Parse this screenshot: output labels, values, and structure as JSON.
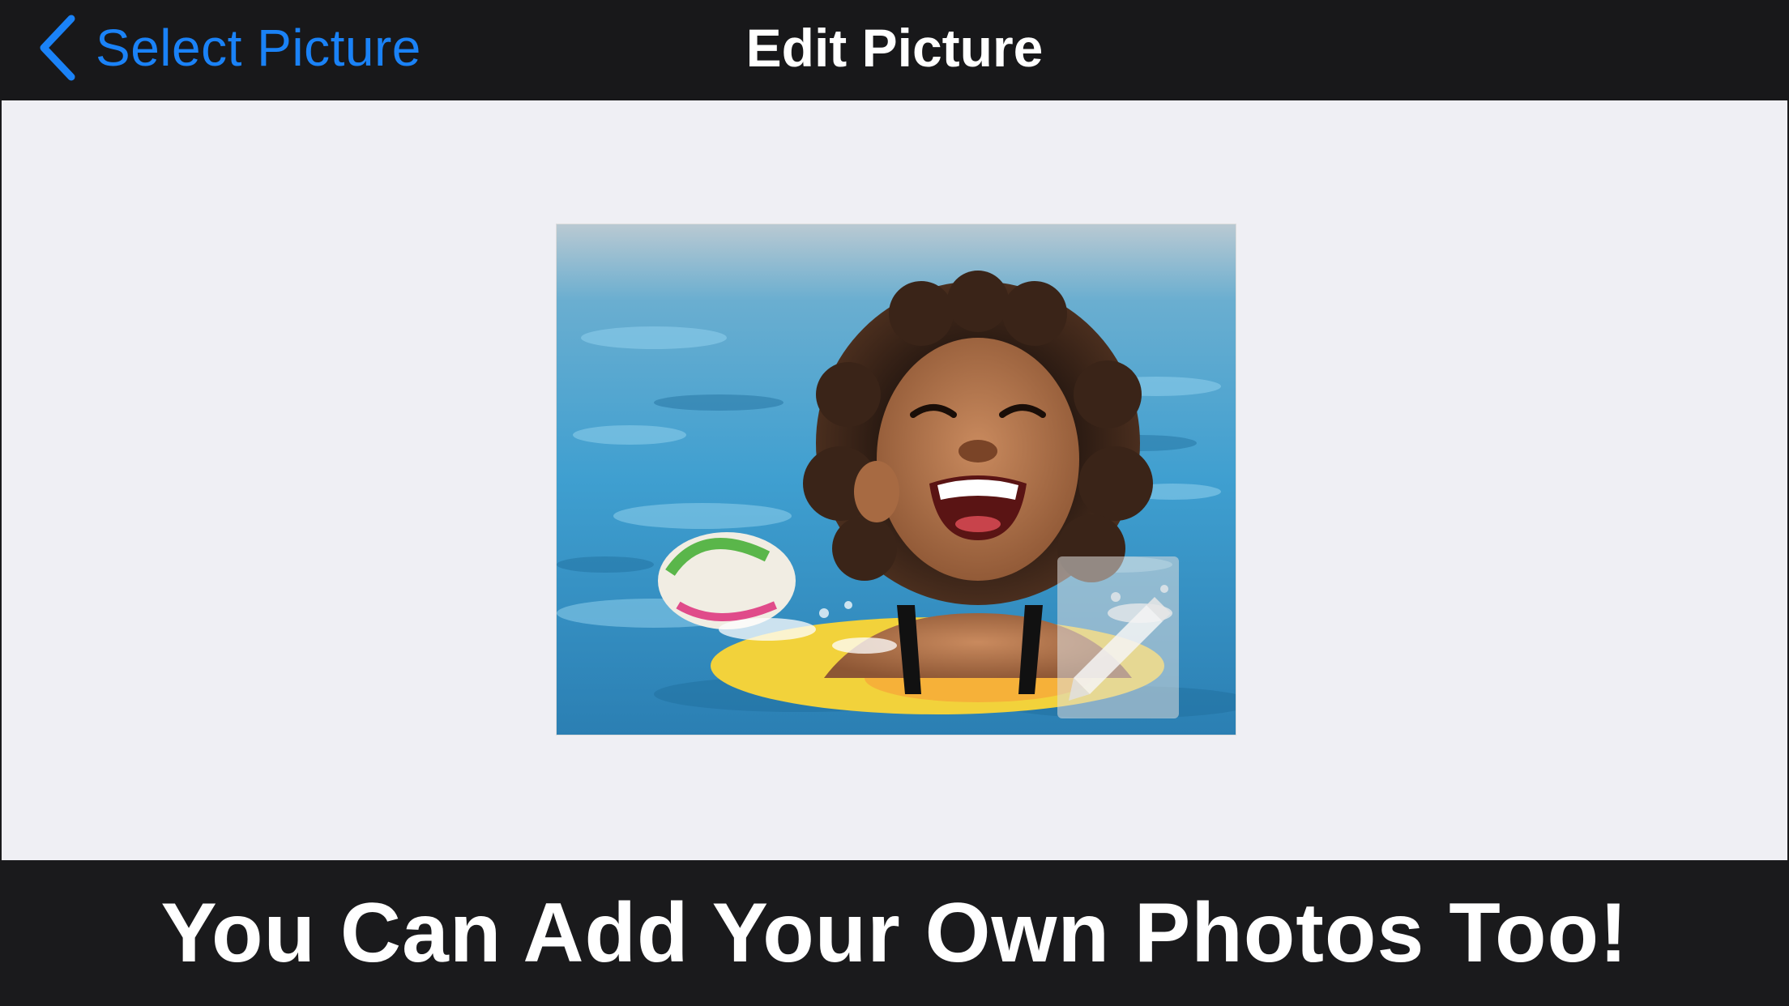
{
  "navbar": {
    "back_label": "Select Picture",
    "title": "Edit Picture",
    "back_icon": "chevron-left-icon",
    "tint_color": "#1a82f7"
  },
  "main": {
    "photo": {
      "subject": "child laughing in a swimming pool with an inflatable ring",
      "overlay_icon": "edit-pencil-icon"
    }
  },
  "caption": {
    "text": "You Can Add Your Own Photos Too!"
  },
  "colors": {
    "navbar_bg": "#18181a",
    "content_bg": "#efeff4",
    "caption_bg": "#1a1a1c",
    "caption_text": "#ffffff"
  }
}
